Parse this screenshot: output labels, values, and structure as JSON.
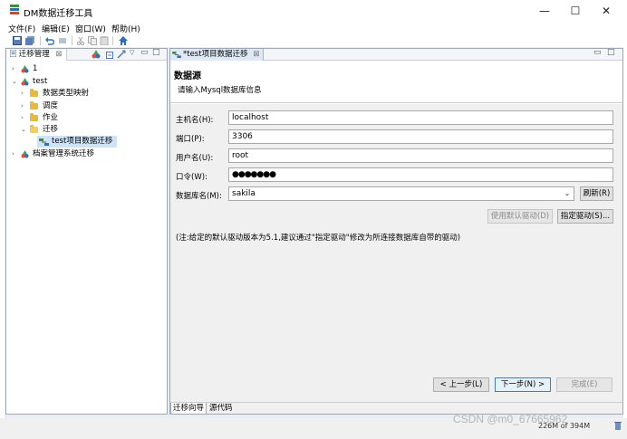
{
  "window": {
    "title": "DM数据迁移工具",
    "minimize_glyph": "—",
    "maximize_glyph": "☐",
    "close_glyph": "✕"
  },
  "menu": [
    "文件(F)",
    "编辑(E)",
    "窗口(W)",
    "帮助(H)"
  ],
  "left_view": {
    "tab_label": "迁移管理",
    "tree": [
      {
        "label": "1",
        "level": 0,
        "expanded": false
      },
      {
        "label": "test",
        "level": 0,
        "expanded": true
      },
      {
        "label": "数据类型映射",
        "level": 1,
        "expanded": false
      },
      {
        "label": "调度",
        "level": 1,
        "expanded": false
      },
      {
        "label": "作业",
        "level": 1,
        "expanded": false
      },
      {
        "label": "迁移",
        "level": 1,
        "expanded": true
      },
      {
        "label": "test项目数据迁移",
        "level": 2,
        "selected": true
      },
      {
        "label": "档案管理系统迁移",
        "level": 0,
        "expanded": false
      }
    ]
  },
  "editor": {
    "tab_label": "*test项目数据迁移",
    "header_title": "数据源",
    "header_desc": "请输入Mysql数据库信息",
    "fields": {
      "host_label": "主机名(H):",
      "host_value": "localhost",
      "port_label": "端口(P):",
      "port_value": "3306",
      "user_label": "用户名(U):",
      "user_value": "root",
      "password_label": "口令(W):",
      "password_value": "●●●●●●●",
      "db_label": "数据库名(M):",
      "db_value": "sakila"
    },
    "refresh_button": "刷新(R)",
    "use_default_driver_button": "使用默认驱动(D)",
    "specify_driver_button": "指定驱动(S)...",
    "note": "(注:给定的默认驱动版本为5.1,建议通过\"指定驱动\"修改为所连接数据库自带的驱动)",
    "prev_button": "< 上一步(L)",
    "next_button": "下一步(N) >",
    "finish_button": "完成(E)",
    "bottom_tabs": [
      "迁移向导",
      "源代码"
    ]
  },
  "status": {
    "memory": "226M of 394M"
  },
  "watermark": "CSDN @m0_67665962",
  "colors": {
    "workarea": "#e9eef5",
    "selection": "#cde3f8",
    "folder": "#e8b844"
  }
}
